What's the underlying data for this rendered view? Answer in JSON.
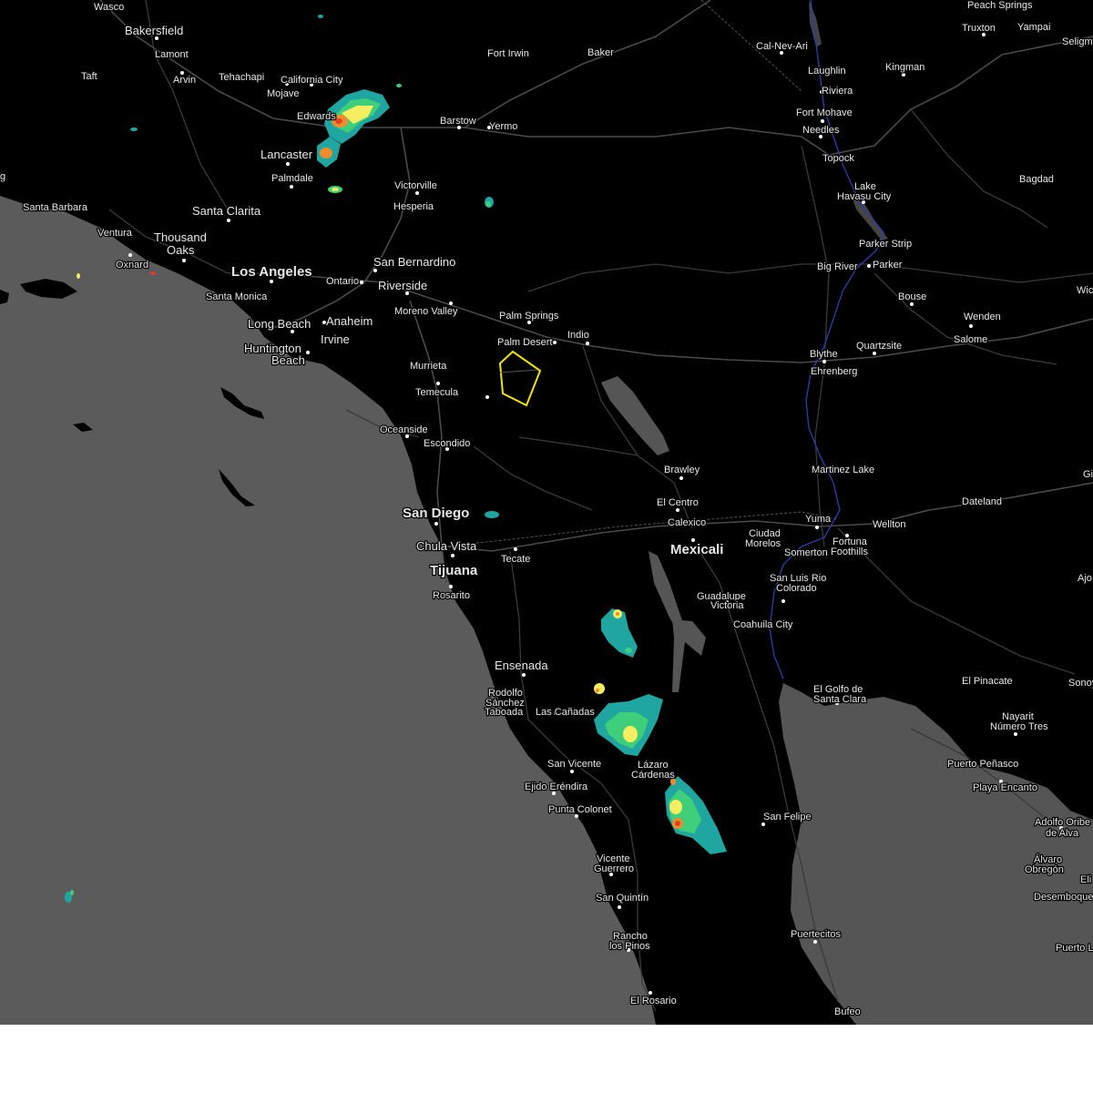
{
  "map": {
    "colors": {
      "land": "#000000",
      "ocean": "#5b5b5b",
      "lake": "#555555",
      "road": "#3a3a3a",
      "river": "#2d3b9a",
      "warning_polygon": "#f2e600",
      "radar_light": "#1fa6a0",
      "radar_mid": "#3fcf7a",
      "radar_high": "#f4ee60",
      "radar_heavy": "#f08c2a",
      "radar_extreme": "#e0402a"
    },
    "places_large": [
      "Los Angeles",
      "San Diego",
      "Tijuana",
      "Mexicali",
      "Ensenada"
    ],
    "places": [
      "Wasco",
      "Bakersfield",
      "Lamont",
      "Arvin",
      "Taft",
      "Tehachapi",
      "California City",
      "Mojave",
      "Edwards",
      "Lancaster",
      "Palmdale",
      "Fort Irwin",
      "Baker",
      "Barstow",
      "Yermo",
      "Victorville",
      "Hesperia",
      "Santa Barbara",
      "Ventura",
      "Santa Clarita",
      "Thousand Oaks",
      "Oxnard",
      "Santa Monica",
      "San Bernardino",
      "Ontario",
      "Riverside",
      "Moreno Valley",
      "Palm Springs",
      "Palm Desert",
      "Indio",
      "Long Beach",
      "Anaheim",
      "Irvine",
      "Huntington Beach",
      "Murrieta",
      "Temecula",
      "Oceanside",
      "Escondido",
      "Chula Vista",
      "Rosarito",
      "Tecate",
      "Brawley",
      "El Centro",
      "Calexico",
      "Ciudad Morelos",
      "Somerton",
      "Yuma",
      "Fortuna Foothills",
      "Wellton",
      "San Luis Rio Colorado",
      "Guadalupe Victoria",
      "Coahuila City",
      "Rodolfo Sánchez Taboada",
      "Las Cañadas",
      "San Vicente",
      "Ejido Eréndira",
      "Lázaro Cárdenas",
      "Punta Colonet",
      "Vicente Guerrero",
      "San Quintín",
      "Rancho los Pinos",
      "El Rosario",
      "San Felipe",
      "Puertecitos",
      "Bufeo",
      "El Golfo de Santa Clara",
      "El Pinacate",
      "Sonoyta",
      "Nayarit Número Tres",
      "Puerto Peñasco",
      "Playa Encanto",
      "Adolfo Oribe de Alva",
      "Álvaro Obregón",
      "Desemboque",
      "Puerto Libertad",
      "Cal-Nev-Ari",
      "Laughlin",
      "Riviera",
      "Fort Mohave",
      "Needles",
      "Topock",
      "Kingman",
      "Lake Havasu City",
      "Parker Strip",
      "Parker",
      "Big River",
      "Bouse",
      "Wenden",
      "Salome",
      "Blythe",
      "Quartzsite",
      "Ehrenberg",
      "Martinez Lake",
      "Dateland",
      "Bagdad",
      "Peach Springs",
      "Truxton",
      "Yampai",
      "Seligman",
      "Wickenburg",
      "Gila Bend",
      "Ajo",
      "Ejido Eréndira"
    ]
  },
  "labels": {
    "wasco": "Wasco",
    "bakersfield": "Bakersfield",
    "lamont": "Lamont",
    "arvin": "Arvin",
    "taft": "Taft",
    "tehachapi": "Tehachapi",
    "california_city": "California City",
    "mojave": "Mojave",
    "edwards": "Edwards",
    "lancaster": "Lancaster",
    "palmdale": "Palmdale",
    "fort_irwin": "Fort Irwin",
    "baker": "Baker",
    "barstow": "Barstow",
    "yermo": "Yermo",
    "victorville": "Victorville",
    "hesperia": "Hesperia",
    "santa_barbara": "Santa Barbara",
    "ventura": "Ventura",
    "santa_clarita": "Santa Clarita",
    "thousand": "Thousand",
    "oaks": "Oaks",
    "oxnard": "Oxnard",
    "los_angeles": "Los Angeles",
    "santa_monica": "Santa Monica",
    "san_bernardino": "San Bernardino",
    "ontario": "Ontario",
    "riverside": "Riverside",
    "moreno_valley": "Moreno Valley",
    "palm_springs": "Palm Springs",
    "palm_desert": "Palm Desert",
    "indio": "Indio",
    "long_beach": "Long Beach",
    "anaheim": "Anaheim",
    "irvine": "Irvine",
    "huntington": "Huntington",
    "beach": "Beach",
    "murrieta": "Murrieta",
    "temecula": "Temecula",
    "oceanside": "Oceanside",
    "escondido": "Escondido",
    "san_diego": "San Diego",
    "chula_vista": "Chula Vista",
    "tijuana": "Tijuana",
    "rosarito": "Rosarito",
    "tecate": "Tecate",
    "brawley": "Brawley",
    "el_centro": "El Centro",
    "calexico": "Calexico",
    "mexicali": "Mexicali",
    "ciudad": "Ciudad",
    "morelos": "Morelos",
    "somerton": "Somerton",
    "yuma": "Yuma",
    "fortuna": "Fortuna",
    "foothills": "Foothills",
    "wellton": "Wellton",
    "san_luis_rio": "San Luis Rio",
    "colorado": "Colorado",
    "guadalupe": "Guadalupe",
    "victoria": "Victoria",
    "coahuila_city": "Coahuila City",
    "ensenada": "Ensenada",
    "rodolfo": "Rodolfo",
    "sanchez": "Sánchez",
    "taboada": "Taboada",
    "las_canadas": "Las Cañadas",
    "san_vicente": "San Vicente",
    "ejido_erendira": "Ejido Eréndira",
    "lazaro": "Lázaro",
    "cardenas": "Cárdenas",
    "punta_colonet": "Punta Colonet",
    "vicente": "Vicente",
    "guerrero": "Guerrero",
    "san_quintin": "San Quintín",
    "rancho": "Rancho",
    "los_pinos": "los Pinos",
    "el_rosario": "El Rosario",
    "san_felipe": "San Felipe",
    "puertecitos": "Puertecitos",
    "bufeo": "Bufeo",
    "el_golfo_de": "El Golfo de",
    "santa_clara": "Santa Clara",
    "el_pinacate": "El Pinacate",
    "sonoy": "Sonoy",
    "nayarit": "Nayarit",
    "numero_tres": "Número Tres",
    "puerto_penasco": "Puerto Peñasco",
    "playa_encanto": "Playa Encanto",
    "adolfo_oribe": "Adolfo Oribe",
    "de_alva": "de Alva",
    "alvaro": "Álvaro",
    "obregon": "Obregón",
    "eli": "Eli",
    "desemboque": "Desemboque",
    "puerto_l": "Puerto L",
    "cal_nev_ari": "Cal-Nev-Ari",
    "laughlin": "Laughlin",
    "riviera": "Riviera",
    "fort_mohave": "Fort Mohave",
    "needles": "Needles",
    "topock": "Topock",
    "kingman": "Kingman",
    "lake": "Lake",
    "havasu_city": "Havasu City",
    "parker_strip": "Parker Strip",
    "big_river": "Big River",
    "parker": "Parker",
    "bouse": "Bouse",
    "wenden": "Wenden",
    "salome": "Salome",
    "blythe": "Blythe",
    "quartzsite": "Quartzsite",
    "ehrenberg": "Ehrenberg",
    "martinez_lake": "Martinez Lake",
    "dateland": "Dateland",
    "bagdad": "Bagdad",
    "peach_springs": "Peach Springs",
    "truxton": "Truxton",
    "yampai": "Yampai",
    "seligm": "Seligm",
    "wic": "Wic",
    "ajo": "Ajo",
    "gi": "Gi",
    "g": "g"
  }
}
